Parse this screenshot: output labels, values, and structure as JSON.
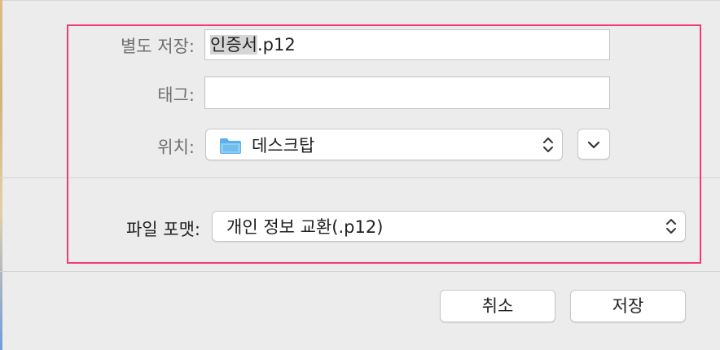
{
  "save_as": {
    "label": "별도 저장:",
    "value_selected": "인증서",
    "value_rest": ".p12"
  },
  "tags": {
    "label": "태그:",
    "value": ""
  },
  "location": {
    "label": "위치:",
    "value": "데스크탑",
    "icon": "folder-icon"
  },
  "file_format": {
    "label": "파일 포맷:",
    "value": "개인 정보 교환(.p12)"
  },
  "buttons": {
    "cancel": "취소",
    "save": "저장"
  },
  "colors": {
    "highlight": "#ee3d78",
    "folder": "#5ab0ea"
  }
}
